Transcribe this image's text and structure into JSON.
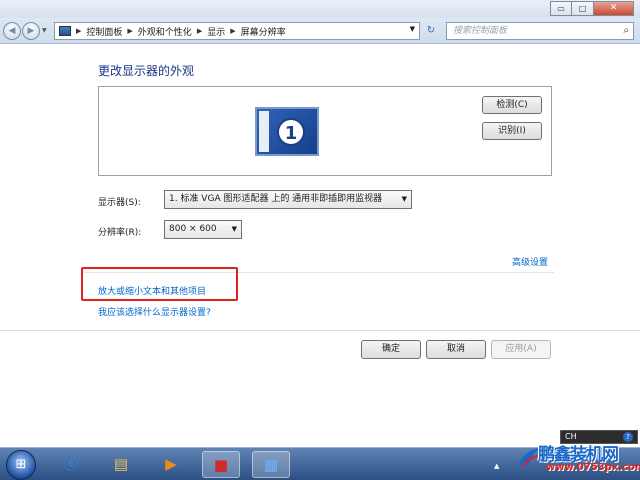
{
  "titlebar": {
    "min_label": "▭",
    "max_label": "□",
    "close_label": "✕"
  },
  "address": {
    "crumbs": [
      "控制面板",
      "外观和个性化",
      "显示",
      "屏幕分辨率"
    ],
    "search_placeholder": "搜索控制面板"
  },
  "main": {
    "heading": "更改显示器的外观",
    "monitor_number": "1",
    "detect_label": "检测(C)",
    "identify_label": "识别(I)",
    "display_label": "显示器(S):",
    "display_value": "1. 标准 VGA 图形适配器 上的 通用非即插即用监视器",
    "resolution_label": "分辨率(R):",
    "resolution_value": "800 × 600",
    "advanced_link": "高级设置",
    "text_size_link": "放大或缩小文本和其他项目",
    "which_settings_link": "我应该选择什么显示器设置?",
    "ok_label": "确定",
    "cancel_label": "取消",
    "apply_label": "应用(A)"
  },
  "tray": {
    "lang_label": "CH"
  },
  "watermark": {
    "title": "鹏鑫装机网",
    "url": "www.0753px.com"
  },
  "colors": {
    "link": "#0066cc",
    "heading": "#1e3287",
    "highlight": "#e0241b",
    "taskbar": "#2b4f83"
  }
}
